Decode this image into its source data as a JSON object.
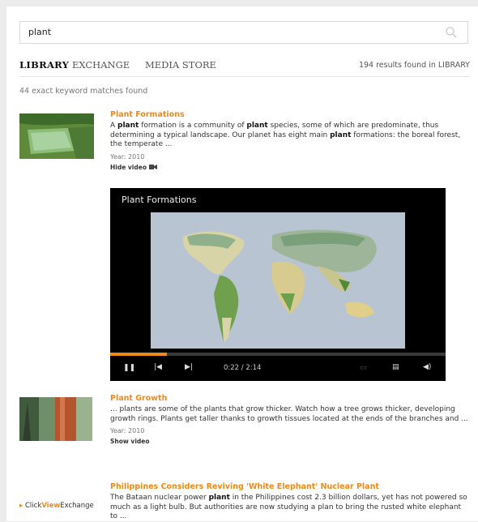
{
  "search": {
    "value": "plant"
  },
  "nav": {
    "tabs": [
      "LIBRARY",
      "EXCHANGE",
      "MEDIA STORE"
    ],
    "results_count": "194 results found in LIBRARY"
  },
  "matches_text": "44 exact keyword matches found",
  "results": [
    {
      "title": "Plant Formations",
      "description_parts": [
        "A ",
        "plant",
        " formation is a community of ",
        "plant",
        " species, some of which are predominate, thus determining a typical landscape. Our planet has eight main ",
        "plant",
        " formations: the boreal forest, the temperate ..."
      ],
      "year": "Year: 2010",
      "toggle": "Hide video",
      "player": {
        "title": "Plant Formations",
        "time": "0:22 / 2:14",
        "progress": 0.17
      }
    },
    {
      "title": "Plant Growth",
      "description": "... plants are some of the plants that grow thicker. Watch how a tree grows thicker, developing growth rings. Plants get taller thanks to growth tissues located at the ends of the branches and ...",
      "year": "Year: 2010",
      "toggle": "Show video"
    },
    {
      "title": "Philippines Considers Reviving 'White Elephant' Nuclear Plant",
      "description_parts": [
        "The Bataan nuclear power ",
        "plant",
        " in the Philippines cost 2.3 billion dollars, yet has not powered so much as a light bulb. But authorities are now studying a plan to bring the rusted white elephant to ..."
      ],
      "logo": {
        "arrow": "▸",
        "a": "Click",
        "b": "View",
        "c": "Exchange"
      }
    }
  ],
  "colors": {
    "accent": "#f08a16"
  }
}
